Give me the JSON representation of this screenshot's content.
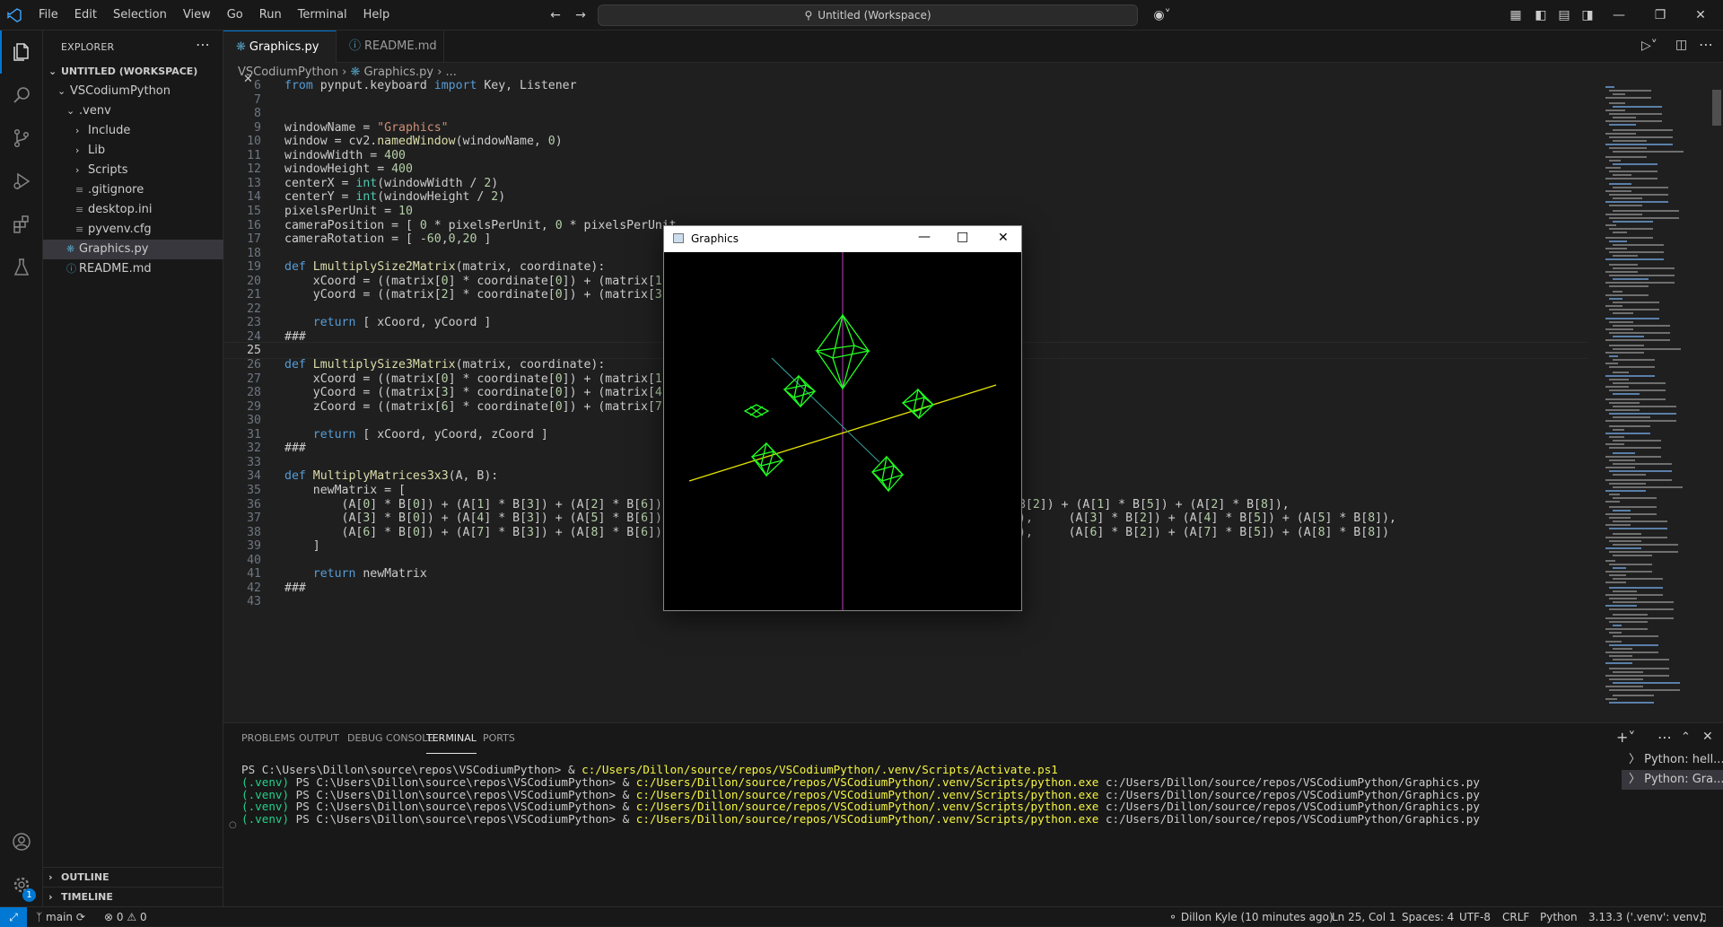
{
  "menu": [
    "File",
    "Edit",
    "Selection",
    "View",
    "Go",
    "Run",
    "Terminal",
    "Help"
  ],
  "title_search": "Untitled (Workspace)",
  "explorer": {
    "title": "EXPLORER",
    "workspace": "UNTITLED (WORKSPACE)",
    "items": [
      {
        "label": "VSCodiumPython",
        "indent": 1,
        "type": "folder-open"
      },
      {
        "label": ".venv",
        "indent": 2,
        "type": "folder-open"
      },
      {
        "label": "Include",
        "indent": 3,
        "type": "folder"
      },
      {
        "label": "Lib",
        "indent": 3,
        "type": "folder"
      },
      {
        "label": "Scripts",
        "indent": 3,
        "type": "folder"
      },
      {
        "label": ".gitignore",
        "indent": 3,
        "type": "file"
      },
      {
        "label": "desktop.ini",
        "indent": 3,
        "type": "file"
      },
      {
        "label": "pyvenv.cfg",
        "indent": 3,
        "type": "file"
      },
      {
        "label": "Graphics.py",
        "indent": 2,
        "type": "py"
      },
      {
        "label": "README.md",
        "indent": 2,
        "type": "md"
      }
    ],
    "outline": "OUTLINE",
    "timeline": "TIMELINE"
  },
  "tabs": [
    {
      "label": "Graphics.py",
      "active": true
    },
    {
      "label": "README.md",
      "active": false
    }
  ],
  "breadcrumb": {
    "folder": "VSCodiumPython",
    "file": "Graphics.py",
    "rest": "..."
  },
  "code_lines": [
    {
      "n": "6",
      "t": "from pynput.keyboard import Key, Listener"
    },
    {
      "n": "7",
      "t": ""
    },
    {
      "n": "8",
      "t": ""
    },
    {
      "n": "9",
      "t": "windowName = \"Graphics\""
    },
    {
      "n": "10",
      "t": "window = cv2.namedWindow(windowName, 0)"
    },
    {
      "n": "11",
      "t": "windowWidth = 400"
    },
    {
      "n": "12",
      "t": "windowHeight = 400"
    },
    {
      "n": "13",
      "t": "centerX = int(windowWidth / 2)"
    },
    {
      "n": "14",
      "t": "centerY = int(windowHeight / 2)"
    },
    {
      "n": "15",
      "t": "pixelsPerUnit = 10"
    },
    {
      "n": "16",
      "t": "cameraPosition = [ 0 * pixelsPerUnit, 0 * pixelsPerUnit"
    },
    {
      "n": "17",
      "t": "cameraRotation = [ -60,0,20 ]"
    },
    {
      "n": "18",
      "t": ""
    },
    {
      "n": "19",
      "t": "def LmultiplySize2Matrix(matrix, coordinate):"
    },
    {
      "n": "20",
      "t": "    xCoord = ((matrix[0] * coordinate[0]) + (matrix[1]"
    },
    {
      "n": "21",
      "t": "    yCoord = ((matrix[2] * coordinate[0]) + (matrix[3]"
    },
    {
      "n": "22",
      "t": ""
    },
    {
      "n": "23",
      "t": "    return [ xCoord, yCoord ]"
    },
    {
      "n": "24",
      "t": "###"
    },
    {
      "n": "25",
      "t": ""
    },
    {
      "n": "26",
      "t": "def LmultiplySize3Matrix(matrix, coordinate):"
    },
    {
      "n": "27",
      "t": "    xCoord = ((matrix[0] * coordinate[0]) + (matrix[1]"
    },
    {
      "n": "28",
      "t": "    yCoord = ((matrix[3] * coordinate[0]) + (matrix[4]"
    },
    {
      "n": "29",
      "t": "    zCoord = ((matrix[6] * coordinate[0]) + (matrix[7]"
    },
    {
      "n": "30",
      "t": ""
    },
    {
      "n": "31",
      "t": "    return [ xCoord, yCoord, zCoord ]"
    },
    {
      "n": "32",
      "t": "###"
    },
    {
      "n": "33",
      "t": ""
    },
    {
      "n": "34",
      "t": "def MultiplyMatrices3x3(A, B):"
    },
    {
      "n": "35",
      "t": "    newMatrix = ["
    },
    {
      "n": "36",
      "t": "        (A[0] * B[0]) + (A[1] * B[3]) + (A[2] * B[6]),                                         (A[0] * B[2]) + (A[1] * B[5]) + (A[2] * B[8]),"
    },
    {
      "n": "37",
      "t": "        (A[3] * B[0]) + (A[4] * B[3]) + (A[5] * B[6]),     (A[3] * B[1]) + (A[4] * B[4]) + (A[5] * B[7]),     (A[3] * B[2]) + (A[4] * B[5]) + (A[5] * B[8]),"
    },
    {
      "n": "38",
      "t": "        (A[6] * B[0]) + (A[7] * B[3]) + (A[8] * B[6]),     (A[6] * B[1]) + (A[7] * B[4]) + (A[8] * B[7]),     (A[6] * B[2]) + (A[7] * B[5]) + (A[8] * B[8])"
    },
    {
      "n": "39",
      "t": "    ]"
    },
    {
      "n": "40",
      "t": ""
    },
    {
      "n": "41",
      "t": "    return newMatrix"
    },
    {
      "n": "42",
      "t": "###"
    },
    {
      "n": "43",
      "t": ""
    }
  ],
  "current_line": "25",
  "panel": {
    "tabs": [
      "PROBLEMS",
      "OUTPUT",
      "DEBUG CONSOLE",
      "TERMINAL",
      "PORTS"
    ],
    "active_tab": "TERMINAL",
    "terminal_lines": [
      {
        "prefix": "",
        "prompt": "PS C:\\Users\\Dillon\\source\\repos\\VSCodiumPython> & ",
        "cmd": "c:/Users/Dillon/source/repos/VSCodiumPython/.venv/Scripts/Activate.ps1",
        "arg": ""
      },
      {
        "prefix": "(.venv) ",
        "prompt": "PS C:\\Users\\Dillon\\source\\repos\\VSCodiumPython> & ",
        "cmd": "c:/Users/Dillon/source/repos/VSCodiumPython/.venv/Scripts/python.exe",
        "arg": " c:/Users/Dillon/source/repos/VSCodiumPython/Graphics.py"
      },
      {
        "prefix": "(.venv) ",
        "prompt": "PS C:\\Users\\Dillon\\source\\repos\\VSCodiumPython> & ",
        "cmd": "c:/Users/Dillon/source/repos/VSCodiumPython/.venv/Scripts/python.exe",
        "arg": " c:/Users/Dillon/source/repos/VSCodiumPython/Graphics.py"
      },
      {
        "prefix": "(.venv) ",
        "prompt": "PS C:\\Users\\Dillon\\source\\repos\\VSCodiumPython> & ",
        "cmd": "c:/Users/Dillon/source/repos/VSCodiumPython/.venv/Scripts/python.exe",
        "arg": " c:/Users/Dillon/source/repos/VSCodiumPython/Graphics.py"
      },
      {
        "prefix": "(.venv) ",
        "prompt": "PS C:\\Users\\Dillon\\source\\repos\\VSCodiumPython> & ",
        "cmd": "c:/Users/Dillon/source/repos/VSCodiumPython/.venv/Scripts/python.exe",
        "arg": " c:/Users/Dillon/source/repos/VSCodiumPython/Graphics.py"
      }
    ],
    "terminals": [
      "Python: hell...",
      "Python: Gra..."
    ]
  },
  "status": {
    "branch": "main",
    "errors": "0",
    "warnings": "0",
    "blame": "Dillon Kyle (10 minutes ago)",
    "position": "Ln 25, Col 1",
    "spaces": "Spaces: 4",
    "encoding": "UTF-8",
    "eol": "CRLF",
    "language": "Python",
    "interpreter": "3.13.3 ('.venv': venv)",
    "badge": "1"
  },
  "graphics_window": {
    "title": "Graphics"
  },
  "colors": {
    "accent": "#0078d4",
    "bg": "#1f1f1f",
    "sidebar": "#181818",
    "wire": "#22ff22",
    "axis_yellow": "#e5e500",
    "axis_magenta": "#c040c0",
    "axis_teal": "#3aa0a0"
  }
}
